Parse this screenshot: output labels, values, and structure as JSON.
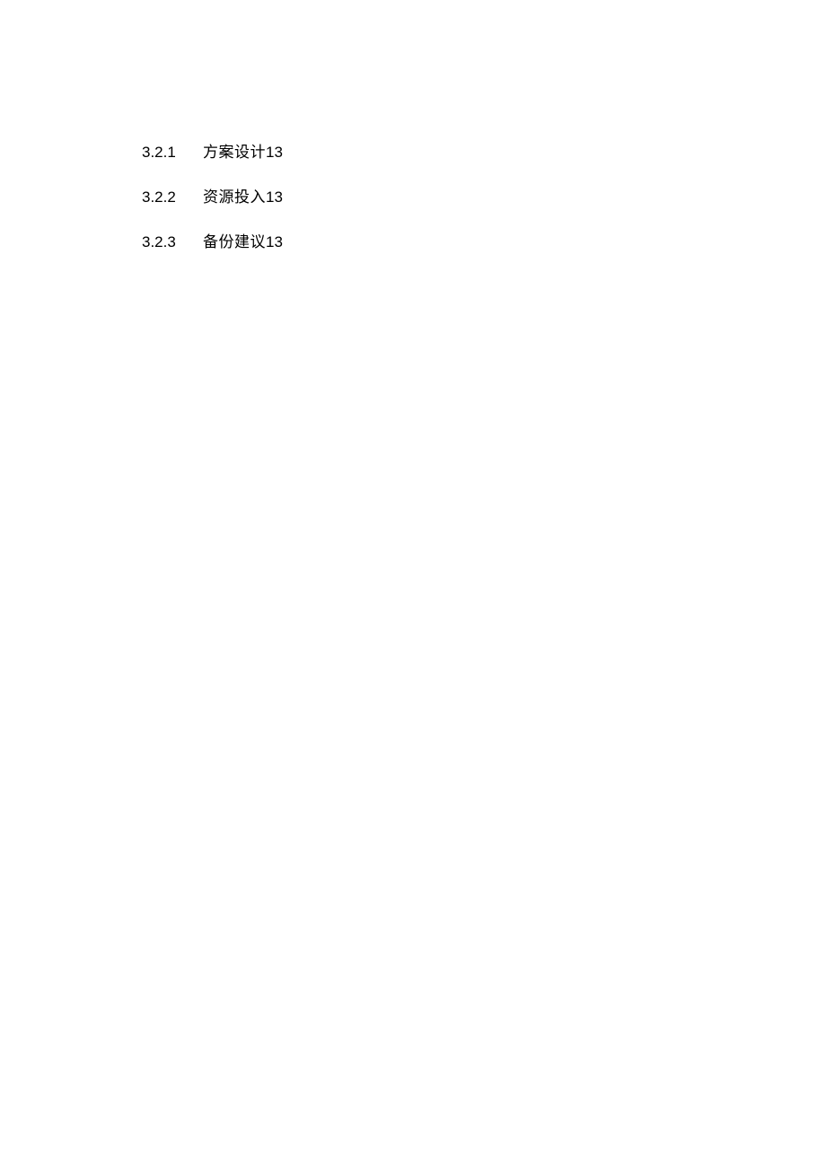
{
  "toc": {
    "entries": [
      {
        "number": "3.2.1",
        "title": "方案设计",
        "page": "13"
      },
      {
        "number": "3.2.2",
        "title": "资源投入",
        "page": "13"
      },
      {
        "number": "3.2.3",
        "title": "备份建议",
        "page": "13"
      }
    ]
  }
}
